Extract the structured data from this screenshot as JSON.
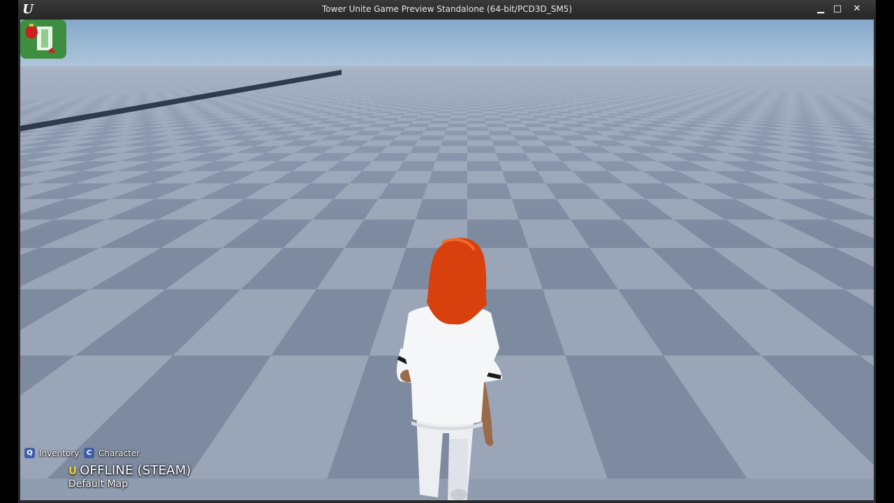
{
  "window": {
    "title": "Tower Unite Game Preview Standalone (64-bit/PCD3D_SM5)",
    "logo": "U",
    "controls": {
      "minimize": "▁",
      "maximize": "□",
      "close": "✕"
    }
  },
  "hud": {
    "hints": [
      {
        "key": "Q",
        "label": "Inventory"
      },
      {
        "key": "C",
        "label": "Character"
      }
    ],
    "status_glyph": "U",
    "status": "OFFLINE (STEAM)",
    "map": "Default Map"
  },
  "colors": {
    "sky_top": "#8fb0cf",
    "sky_bottom": "#b9cde0",
    "tile_light": "#9aa6b8",
    "tile_dark": "#7e8aa0",
    "hair": "#d8400e",
    "shirt": "#f4f4f6",
    "key_badge": "#3f5fa8"
  },
  "icons": [
    "unreal-logo-icon",
    "minimize-icon",
    "maximize-icon",
    "close-icon",
    "status-icon",
    "ornament-icon"
  ]
}
